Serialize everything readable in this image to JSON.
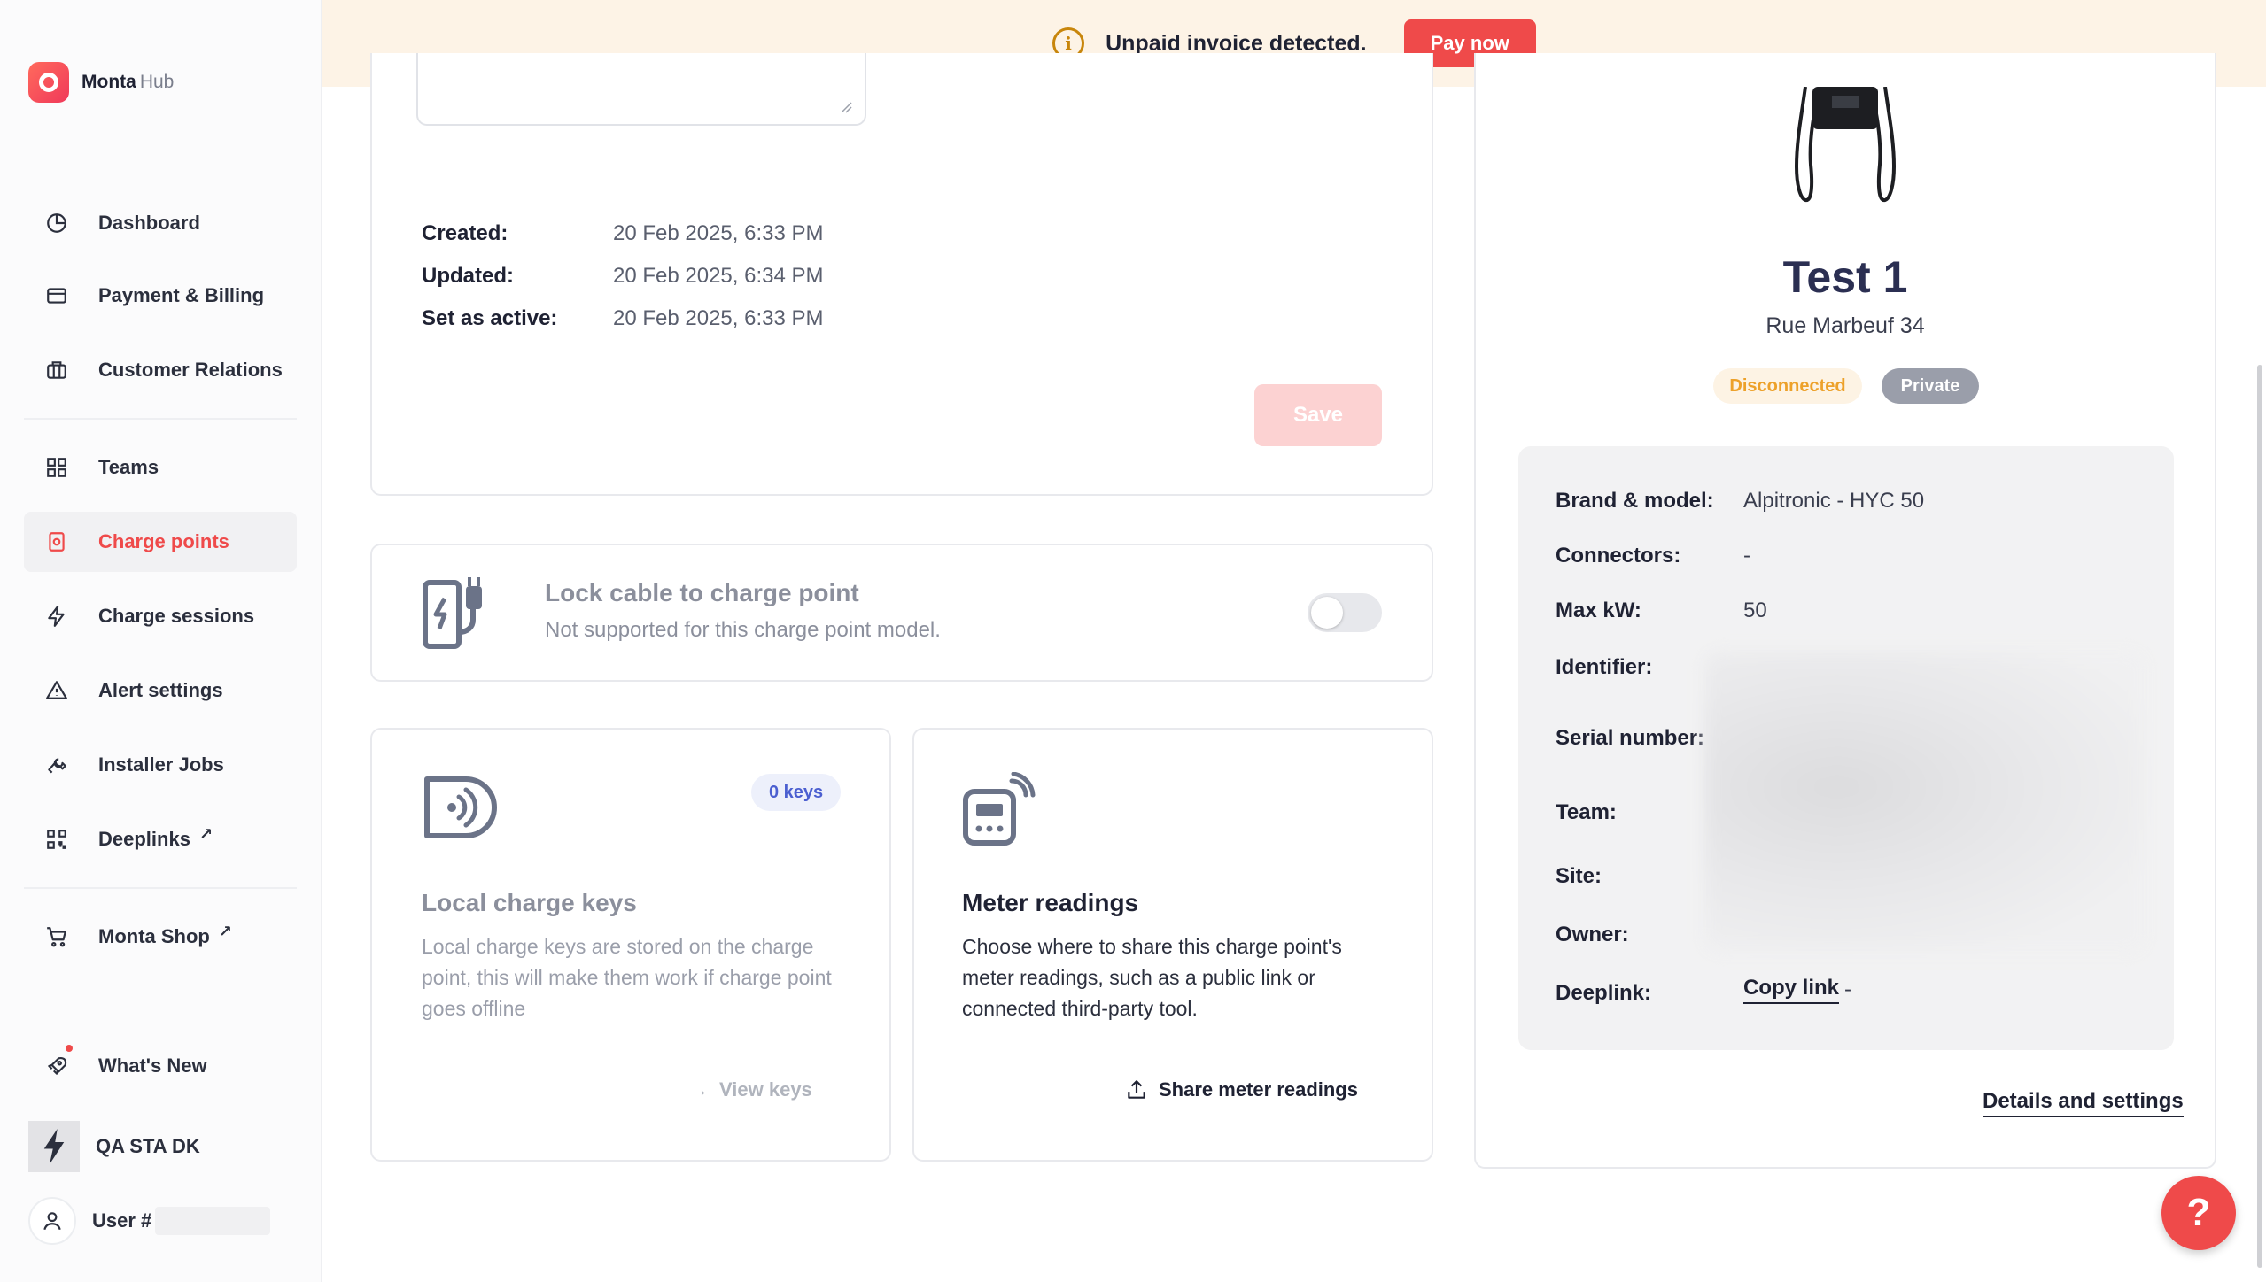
{
  "brand": {
    "name": "Monta",
    "suffix": "Hub"
  },
  "sidebar": {
    "items": [
      {
        "label": "Dashboard",
        "icon": "dashboard-icon"
      },
      {
        "label": "Payment & Billing",
        "icon": "credit-card-icon"
      },
      {
        "label": "Customer Relations",
        "icon": "briefcase-icon"
      },
      {
        "label": "Teams",
        "icon": "grid-icon"
      },
      {
        "label": "Charge points",
        "icon": "charge-point-icon",
        "active": true
      },
      {
        "label": "Charge sessions",
        "icon": "lightning-icon"
      },
      {
        "label": "Alert settings",
        "icon": "alert-icon"
      },
      {
        "label": "Installer Jobs",
        "icon": "wrench-icon"
      },
      {
        "label": "Deeplinks",
        "icon": "qr-code-icon",
        "external": true
      },
      {
        "label": "Monta Shop",
        "icon": "cart-icon",
        "external": true
      },
      {
        "label": "What's New",
        "icon": "rocket-icon",
        "notification": true
      }
    ],
    "team": "QA STA DK",
    "user": "User #"
  },
  "banner": {
    "text": "Unpaid invoice detected.",
    "button": "Pay now"
  },
  "meta": {
    "created_label": "Created:",
    "created_value": "20 Feb 2025, 6:33 PM",
    "updated_label": "Updated:",
    "updated_value": "20 Feb 2025, 6:34 PM",
    "active_label": "Set as active:",
    "active_value": "20 Feb 2025, 6:33 PM",
    "save_label": "Save"
  },
  "lock_cable": {
    "title": "Lock cable to charge point",
    "subtitle": "Not supported for this charge point model.",
    "enabled": false
  },
  "local_keys": {
    "badge": "0 keys",
    "title": "Local charge keys",
    "description": "Local charge keys are stored on the charge point, this will make them work if charge point goes offline",
    "action": "View keys"
  },
  "meter": {
    "title": "Meter readings",
    "description": "Choose where to share this charge point's meter readings, such as a public link or connected third-party tool.",
    "action": "Share meter readings"
  },
  "charge_point": {
    "name": "Test 1",
    "address": "Rue Marbeuf 34",
    "status": "Disconnected",
    "visibility": "Private",
    "details": {
      "brand_label": "Brand & model:",
      "brand_value": "Alpitronic - HYC 50",
      "connectors_label": "Connectors:",
      "connectors_value": "-",
      "maxkw_label": "Max kW:",
      "maxkw_value": "50",
      "identifier_label": "Identifier:",
      "serial_label": "Serial number:",
      "team_label": "Team:",
      "site_label": "Site:",
      "owner_label": "Owner:",
      "deeplink_label": "Deeplink:",
      "deeplink_action": "Copy link",
      "deeplink_dash": "-"
    },
    "settings_link": "Details and settings"
  },
  "help": "?",
  "colors": {
    "accent": "#ef4a4a",
    "banner_bg": "#fdf3e6",
    "warning": "#eda12a"
  }
}
